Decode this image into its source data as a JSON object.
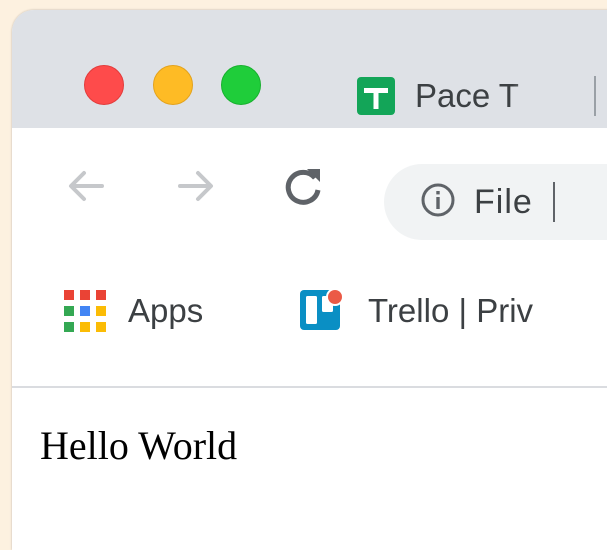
{
  "window": {
    "traffic_lights": {
      "close_color": "#fe4b4b",
      "minimize_color": "#febb25",
      "maximize_color": "#1fcd3a"
    }
  },
  "tab": {
    "title": "Pace T",
    "favicon": "google-sheets-icon",
    "favicon_color": "#13a558"
  },
  "toolbar": {
    "back_icon": "arrow-left-icon",
    "forward_icon": "arrow-right-icon",
    "reload_icon": "reload-icon",
    "omnibox": {
      "info_icon": "info-icon",
      "text": "File"
    }
  },
  "bookmarks": [
    {
      "label": "Apps",
      "icon": "apps-grid-icon"
    },
    {
      "label": "Trello | Priv",
      "icon": "trello-icon"
    }
  ],
  "content": {
    "text": "Hello World"
  }
}
